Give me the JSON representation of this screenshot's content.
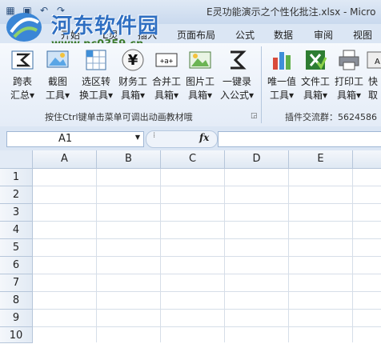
{
  "window": {
    "title": "E灵功能演示之个性化批注.xlsx - Micro"
  },
  "watermark": {
    "site_name": "河东软件园",
    "url": "www.pc0359.cn"
  },
  "tabs": [
    "开始",
    "E灵",
    "插入",
    "页面布局",
    "公式",
    "数据",
    "审阅",
    "视图"
  ],
  "ribbon": {
    "buttons": [
      {
        "name": "跨表汇总",
        "l1": "跨表",
        "l2": "汇总▾",
        "icon": "sigma-table-icon"
      },
      {
        "name": "截图工具",
        "l1": "截图",
        "l2": "工具▾",
        "icon": "screenshot-icon"
      },
      {
        "name": "选区转换工具",
        "l1": "选区转",
        "l2": "换工具▾",
        "icon": "convert-grid-icon"
      },
      {
        "name": "财务工具箱",
        "l1": "财务工",
        "l2": "具箱▾",
        "icon": "yen-icon"
      },
      {
        "name": "合并工具箱",
        "l1": "合并工",
        "l2": "具箱▾",
        "icon": "merge-icon"
      },
      {
        "name": "图片工具箱",
        "l1": "图片工",
        "l2": "具箱▾",
        "icon": "picture-icon"
      },
      {
        "name": "一键录入公式",
        "l1": "一键录",
        "l2": "入公式▾",
        "icon": "sigma-icon"
      },
      {
        "name": "唯一值工具",
        "l1": "唯一值",
        "l2": "工具▾",
        "icon": "bar-chart-icon"
      },
      {
        "name": "文件工具箱",
        "l1": "文件工",
        "l2": "具箱▾",
        "icon": "excel-file-icon"
      },
      {
        "name": "打印工具箱",
        "l1": "打印工",
        "l2": "具箱▾",
        "icon": "printer-icon"
      },
      {
        "name": "快速取",
        "l1": "快",
        "l2": "取",
        "icon": "quick-icon"
      }
    ],
    "group1_label": "按住Ctrl键单击菜单可调出动画教材哦",
    "group2_label": "插件交流群：5624586"
  },
  "formula_bar": {
    "name_box": "A1",
    "fx": "fx",
    "formula": ""
  },
  "sheet": {
    "columns": [
      "A",
      "B",
      "C",
      "D",
      "E"
    ],
    "rows": [
      "1",
      "2",
      "3",
      "4",
      "5",
      "6",
      "7",
      "8",
      "9",
      "10"
    ]
  },
  "colors": {
    "accent": "#2f6fc2",
    "ribbon_bg": "#e4ecf7",
    "grid_line": "#d6dee8"
  }
}
